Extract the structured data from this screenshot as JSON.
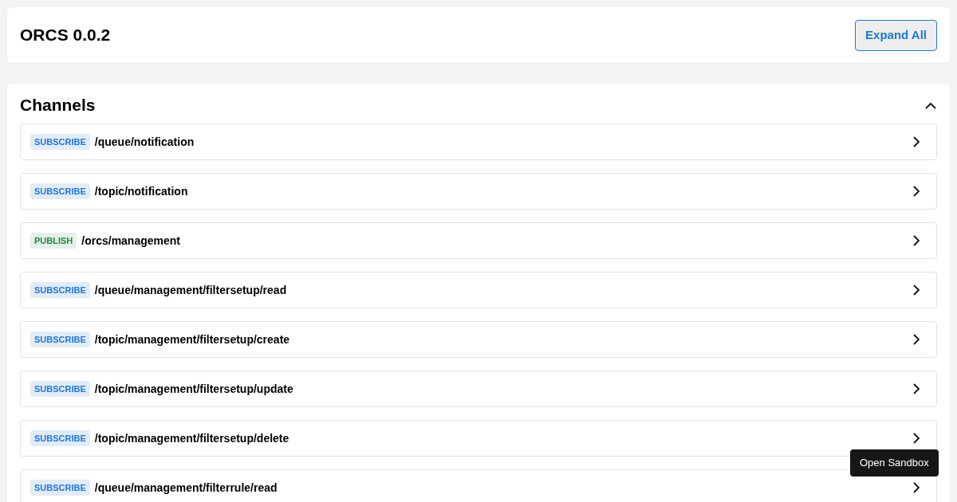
{
  "header": {
    "title": "ORCS 0.0.2",
    "expand_button": "Expand All"
  },
  "channels_section": {
    "title": "Channels",
    "expanded": true,
    "channels": [
      {
        "kind": "subscribe",
        "operation": "SUBSCRIBE",
        "path": "/queue/notification",
        "expanded": false
      },
      {
        "kind": "subscribe",
        "operation": "SUBSCRIBE",
        "path": "/topic/notification",
        "expanded": false
      },
      {
        "kind": "publish",
        "operation": "PUBLISH",
        "path": "/orcs/management",
        "expanded": false
      },
      {
        "kind": "subscribe",
        "operation": "SUBSCRIBE",
        "path": "/queue/management/filtersetup/read",
        "expanded": false
      },
      {
        "kind": "subscribe",
        "operation": "SUBSCRIBE",
        "path": "/topic/management/filtersetup/create",
        "expanded": false
      },
      {
        "kind": "subscribe",
        "operation": "SUBSCRIBE",
        "path": "/topic/management/filtersetup/update",
        "expanded": false
      },
      {
        "kind": "subscribe",
        "operation": "SUBSCRIBE",
        "path": "/topic/management/filtersetup/delete",
        "expanded": false
      },
      {
        "kind": "subscribe",
        "operation": "SUBSCRIBE",
        "path": "/queue/management/filterrule/read",
        "expanded": false
      }
    ]
  },
  "sandbox_button": "Open Sandbox"
}
